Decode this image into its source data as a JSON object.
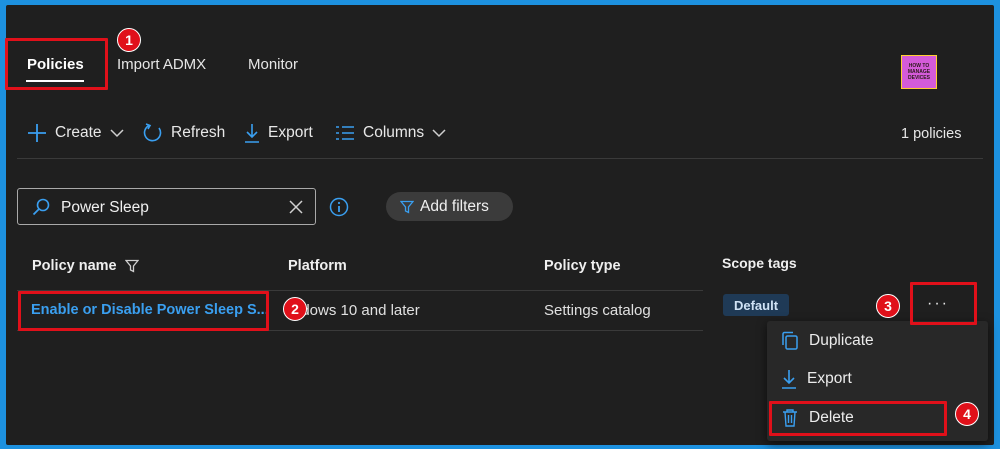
{
  "tabs": [
    {
      "label": "Policies",
      "active": true
    },
    {
      "label": "Import ADMX",
      "active": false
    },
    {
      "label": "Monitor",
      "active": false
    }
  ],
  "logo": {
    "line1": "HOW TO",
    "line2": "MANAGE",
    "line3": "DEVICES"
  },
  "toolbar": {
    "create_label": "Create",
    "refresh_label": "Refresh",
    "export_label": "Export",
    "columns_label": "Columns",
    "count_text": "1 policies"
  },
  "search": {
    "value": "Power Sleep"
  },
  "filters": {
    "add_label": "Add filters"
  },
  "table": {
    "headers": {
      "policy_name": "Policy name",
      "platform": "Platform",
      "policy_type": "Policy type",
      "scope_tags": "Scope tags"
    },
    "rows": [
      {
        "policy_name": "Enable or Disable Power Sleep S...",
        "platform": "Windows 10 and later",
        "platform_visible": "ndows 10 and later",
        "policy_type": "Settings catalog",
        "scope_tag": "Default",
        "more": "···"
      }
    ]
  },
  "context_menu": {
    "items": [
      "Duplicate",
      "Export",
      "Delete"
    ]
  },
  "markers": [
    "1",
    "2",
    "3",
    "4"
  ],
  "colors": {
    "outer_border": "#1d91df",
    "background": "#1f1f1f",
    "accent_blue": "#3a9ff0",
    "highlight_red": "#e0101a",
    "badge_bg": "#1f3a56"
  }
}
